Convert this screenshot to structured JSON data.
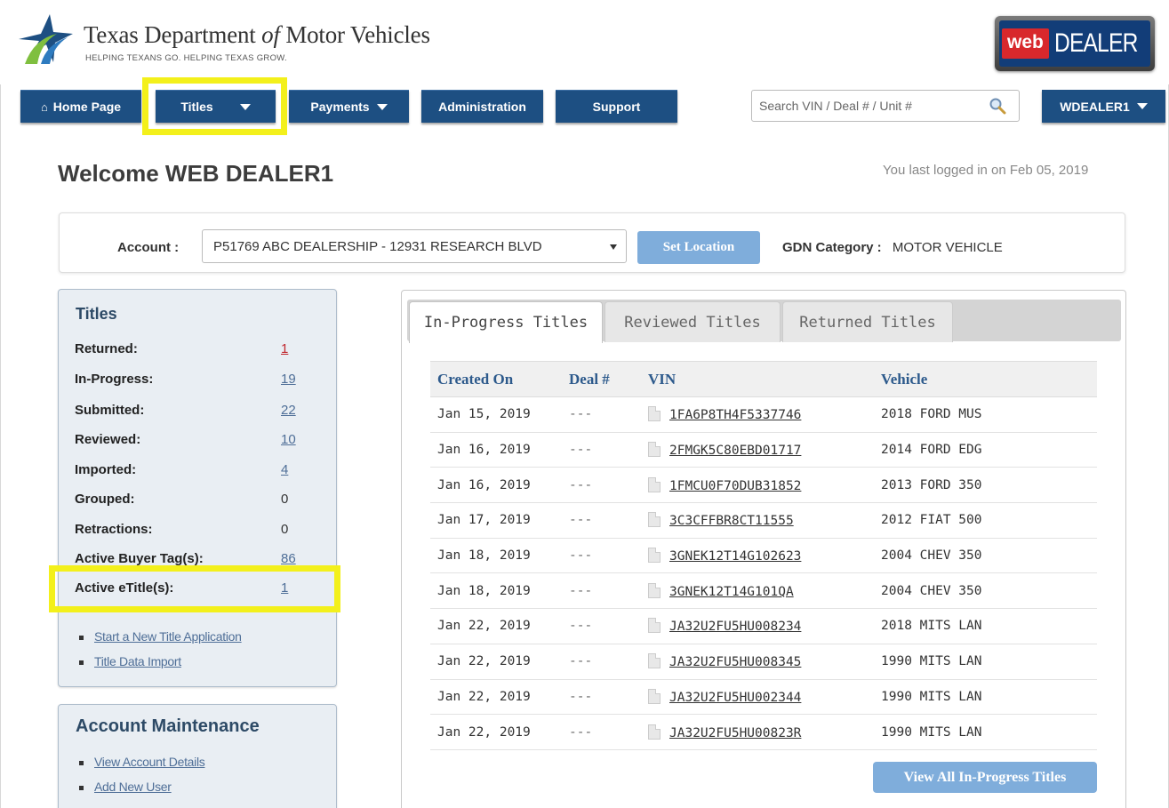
{
  "header": {
    "org_name_pre": "Texas Department",
    "org_name_of": "of",
    "org_name_post": "Motor Vehicles",
    "tagline": "HELPING TEXANS GO. HELPING TEXAS GROW.",
    "brand_web": "web",
    "brand_dealer": "DEALER"
  },
  "nav": {
    "home": "Home Page",
    "home_icon": "home-icon",
    "titles": "Titles",
    "payments": "Payments",
    "administration": "Administration",
    "support": "Support",
    "search_placeholder": "Search VIN / Deal # / Unit #",
    "user": "WDEALER1"
  },
  "welcome": {
    "title": "Welcome WEB DEALER1",
    "last_login": "You last logged in on Feb 05, 2019"
  },
  "account_bar": {
    "label": "Account :",
    "selected": "P51769   ABC DEALERSHIP - 12931 RESEARCH BLVD",
    "set_location": "Set Location",
    "gdn_label": "GDN Category :",
    "gdn_value": "MOTOR VEHICLE"
  },
  "titles_panel": {
    "heading": "Titles",
    "stats": [
      {
        "label": "Returned:",
        "value": "1"
      },
      {
        "label": "In-Progress:",
        "value": "19"
      },
      {
        "label": "Submitted:",
        "value": "22"
      },
      {
        "label": "Reviewed:",
        "value": "10"
      },
      {
        "label": "Imported:",
        "value": "4"
      },
      {
        "label": "Grouped:",
        "value": "0"
      },
      {
        "label": "Retractions:",
        "value": "0"
      },
      {
        "label": "Active Buyer Tag(s):",
        "value": "86"
      },
      {
        "label": "Active eTitle(s):",
        "value": "1"
      }
    ],
    "links": [
      "Start a New Title Application",
      "Title Data Import"
    ]
  },
  "account_panel": {
    "heading": "Account Maintenance",
    "links": [
      "View Account Details",
      "Add New User"
    ]
  },
  "tabs": [
    "In-Progress Titles",
    "Reviewed Titles",
    "Returned Titles"
  ],
  "table": {
    "columns": [
      "Created On",
      "Deal #",
      "VIN",
      "Vehicle"
    ],
    "rows": [
      {
        "created": "Jan 15, 2019",
        "deal": "---",
        "vin": "1FA6P8TH4F5337746",
        "vehicle": "2018 FORD MUS"
      },
      {
        "created": "Jan 16, 2019",
        "deal": "---",
        "vin": "2FMGK5C80EBD01717",
        "vehicle": "2014 FORD EDG"
      },
      {
        "created": "Jan 16, 2019",
        "deal": "---",
        "vin": "1FMCU0F70DUB31852",
        "vehicle": "2013 FORD 350"
      },
      {
        "created": "Jan 17, 2019",
        "deal": "---",
        "vin": "3C3CFFBR8CT11555",
        "vehicle": "2012 FIAT 500"
      },
      {
        "created": "Jan 18, 2019",
        "deal": "---",
        "vin": "3GNEK12T14G102623",
        "vehicle": "2004 CHEV 350"
      },
      {
        "created": "Jan 18, 2019",
        "deal": "---",
        "vin": "3GNEK12T14G101QA",
        "vehicle": "2004 CHEV 350"
      },
      {
        "created": "Jan 22, 2019",
        "deal": "---",
        "vin": "JA32U2FU5HU008234",
        "vehicle": "2018 MITS LAN"
      },
      {
        "created": "Jan 22, 2019",
        "deal": "---",
        "vin": "JA32U2FU5HU008345",
        "vehicle": "1990 MITS LAN"
      },
      {
        "created": "Jan 22, 2019",
        "deal": "---",
        "vin": "JA32U2FU5HU002344",
        "vehicle": "1990 MITS LAN"
      },
      {
        "created": "Jan 22, 2019",
        "deal": "---",
        "vin": "JA32U2FU5HU00823R",
        "vehicle": "1990 MITS LAN"
      }
    ],
    "view_all": "View All In-Progress Titles"
  },
  "colors": {
    "nav_blue": "#1d4f82",
    "button_light_blue": "#7faddb",
    "highlight_yellow": "#f3f01b",
    "link_blue": "#4e6e97",
    "returned_red": "#c0272d"
  }
}
